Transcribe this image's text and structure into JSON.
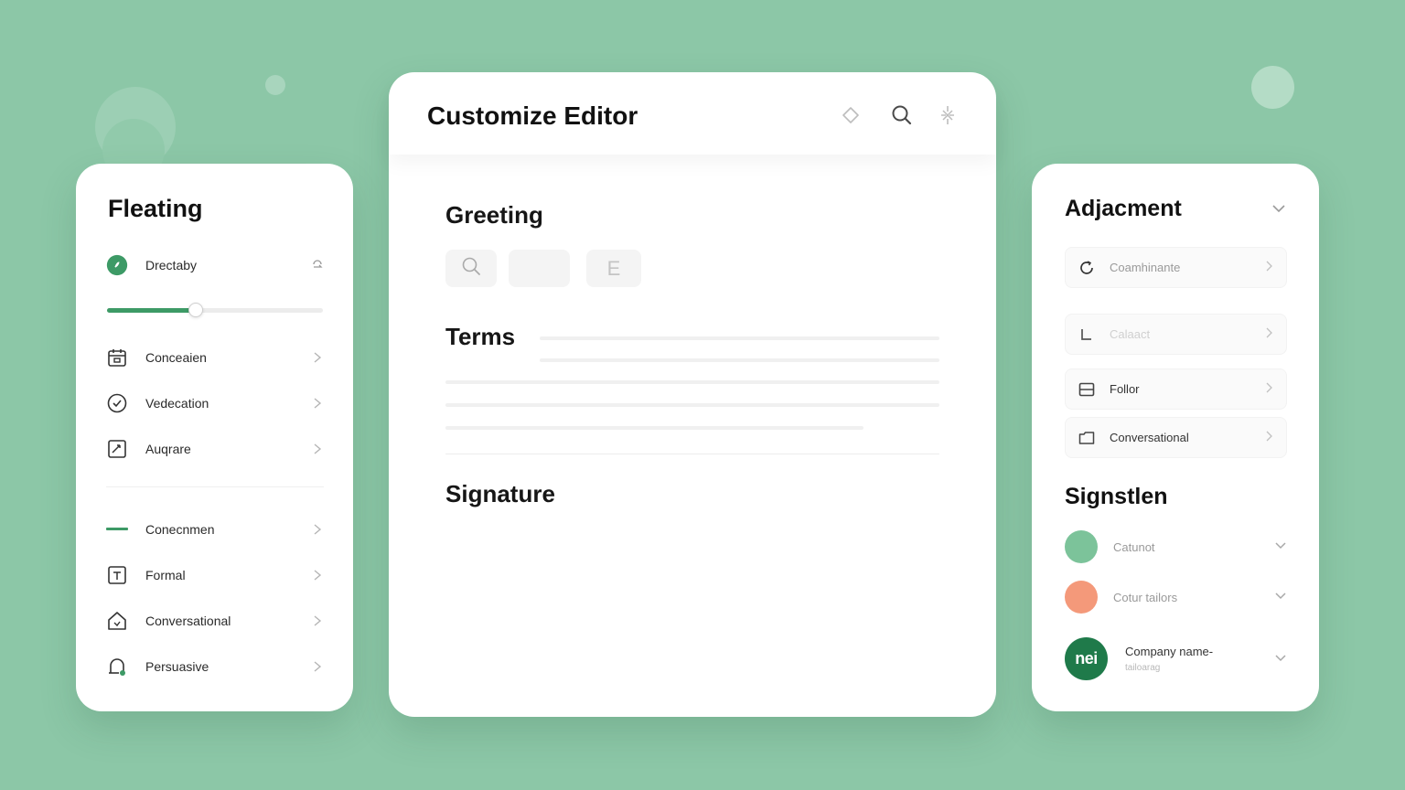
{
  "colors": {
    "accent": "#3d9a66",
    "dark_green": "#1f7a4a",
    "background": "#8cc7a7",
    "salmon": "#f4997a",
    "light_green": "#7cc39a"
  },
  "left_panel": {
    "title": "Fleating",
    "top_item": {
      "label": "Drectaby",
      "icon": "leaf-icon",
      "trailing_icon": "refresh-icon"
    },
    "slider": {
      "value": 0.41
    },
    "items": [
      {
        "label": "Conceaien",
        "icon": "calendar-icon"
      },
      {
        "label": "Vedecation",
        "icon": "check-circle-icon"
      },
      {
        "label": "Auqrare",
        "icon": "edit-square-icon"
      },
      {
        "label": "Conecnmen",
        "icon": "dash-icon"
      },
      {
        "label": "Formal",
        "icon": "text-box-icon"
      },
      {
        "label": "Conversational",
        "icon": "house-icon"
      },
      {
        "label": "Persuasive",
        "icon": "bell-icon"
      }
    ]
  },
  "center_panel": {
    "title": "Customize Editor",
    "header_icons": [
      "diamond-icon",
      "search-icon",
      "sparkle-icon"
    ],
    "sections": {
      "greeting": "Greeting",
      "terms": "Terms",
      "signature": "Signature"
    },
    "greeting_chips": [
      {
        "icon": "search-icon",
        "label": ""
      },
      {
        "icon": "",
        "label": ""
      },
      {
        "icon": "",
        "label": "E"
      }
    ]
  },
  "right_panel": {
    "title": "Adjacment",
    "items": [
      {
        "label": "Coamhinante",
        "icon": "refresh-circle-icon",
        "muted": true
      },
      {
        "label": "Calaact",
        "icon": "corner-icon",
        "muted": true
      },
      {
        "label": "Follor",
        "icon": "list-box-icon",
        "muted": false
      },
      {
        "label": "Conversational",
        "icon": "folder-icon",
        "muted": false
      }
    ],
    "signature_title": "Signstlen",
    "signature_items": [
      {
        "label": "Catunot",
        "color": "#7cc39a"
      },
      {
        "label": "Cotur tailors",
        "color": "#f4997a"
      }
    ],
    "company": {
      "badge": "nei",
      "name": "Company name-",
      "subtitle": "tailoarag"
    }
  }
}
